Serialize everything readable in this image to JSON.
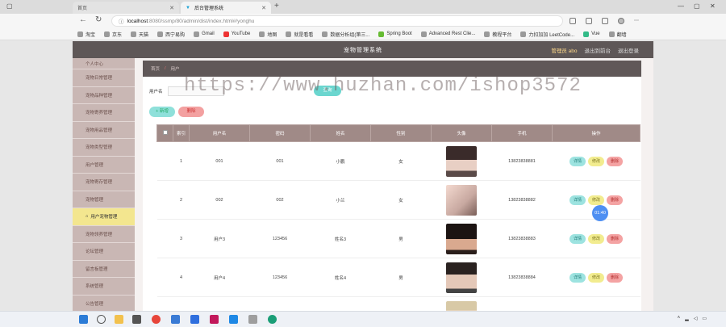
{
  "browser": {
    "tabs": [
      {
        "label": "首页"
      },
      {
        "label": "后台管理系统"
      }
    ],
    "new_tab": "+",
    "address": {
      "prefix": "ⓘ",
      "host": "localhost",
      "path": ":8080/ssmp/80/admin/dist/index.html#/yonghu"
    },
    "bookmarks": [
      "淘宝",
      "京东",
      "天猫",
      "西宁易购",
      "Gmail",
      "YouTube",
      "地图",
      "就是看看",
      "数据分析组(第三...",
      "Spring Boot",
      "Advanced Rest Clie...",
      "教程平台",
      "力扣加加 LeetCode...",
      "Vue",
      "翻墙"
    ]
  },
  "app": {
    "title": "宠物管理系统",
    "user_label": "管理员 abo",
    "exit_to_front": "退出到前台",
    "logout": "退出登录"
  },
  "sidebar": {
    "items": [
      {
        "label": "个人中心"
      },
      {
        "label": "宠物日常管理"
      },
      {
        "label": "宠物品种管理"
      },
      {
        "label": "宠物寄养管理"
      },
      {
        "label": "宠物用品管理"
      },
      {
        "label": "宠物类型管理"
      },
      {
        "label": "用户管理"
      },
      {
        "label": "宠物寄存管理"
      },
      {
        "label": "宠物管理"
      },
      {
        "label": "用户宠物管理"
      },
      {
        "label": "宠物领养管理"
      },
      {
        "label": "论坛管理"
      },
      {
        "label": "留言板管理"
      },
      {
        "label": "系统管理"
      },
      {
        "label": "公告管理"
      }
    ],
    "active_index": 9
  },
  "breadcrumb": {
    "home": "首页",
    "sep": "/",
    "current": "用户"
  },
  "search": {
    "label": "用户名",
    "button": "查询"
  },
  "actions": {
    "add": "+ 新增",
    "delete": "删除"
  },
  "table": {
    "headers": [
      "索引",
      "用户名",
      "密码",
      "姓名",
      "性别",
      "头像",
      "手机",
      "操作"
    ],
    "rows": [
      {
        "index": "1",
        "username": "001",
        "password": "001",
        "name": "小鹏",
        "gender": "女",
        "phone": "13823838881"
      },
      {
        "index": "2",
        "username": "002",
        "password": "002",
        "name": "小兰",
        "gender": "女",
        "phone": "13823838882"
      },
      {
        "index": "3",
        "username": "用户3",
        "password": "123456",
        "name": "姓名3",
        "gender": "男",
        "phone": "13823838883"
      },
      {
        "index": "4",
        "username": "用户4",
        "password": "123456",
        "name": "姓名4",
        "gender": "男",
        "phone": "13823838884"
      }
    ],
    "ops": {
      "view": "详情",
      "edit": "修改",
      "delete": "删除"
    }
  },
  "fab": "01:40",
  "watermark": "https://www.huzhan.com/ishop3572",
  "colors": {
    "topbar": "#5e5757",
    "sidebar": "#c9b7b4",
    "sidebar_active": "#f3e68f",
    "table_header": "#a08a87",
    "accent_teal": "#6bd6cf",
    "accent_red": "#f3a0a0"
  }
}
